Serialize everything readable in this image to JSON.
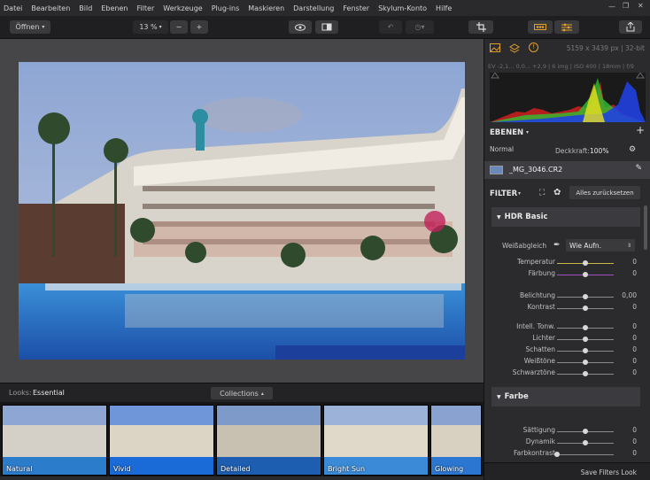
{
  "menu": [
    "Datei",
    "Bearbeiten",
    "Bild",
    "Ebenen",
    "Filter",
    "Werkzeuge",
    "Plug-ins",
    "Maskieren",
    "Darstellung",
    "Fenster",
    "Skylum-Konto",
    "Hilfe"
  ],
  "toolbar": {
    "open_label": "Öffnen",
    "zoom_value": "13 %"
  },
  "panel": {
    "image_info": "5159 x 3439 px  |  32-bit",
    "exif": "EV -2,1... 0,0... +2,9  |  6 img  |  ISO 400  |  18mm  |  f/9",
    "layers_title": "EBENEN",
    "blend_mode": "Normal",
    "opacity_label": "Deckkraft:",
    "opacity_value": "100%",
    "layer_name": "_MG_3046.CR2",
    "filter_title": "FILTER",
    "reset_label": "Alles zurücksetzen",
    "hdr_section": "HDR Basic",
    "wb_label": "Weißabgleich",
    "wb_value": "Wie Aufn.",
    "color_section": "Farbe",
    "save_looks": "Save Filters Look",
    "sliders": [
      {
        "name": "Temperatur",
        "value": "0",
        "level": 0.5,
        "color": "#c8b84a"
      },
      {
        "name": "Färbung",
        "value": "0",
        "level": 0.5,
        "color": "#a050c0"
      },
      {
        "name": "Belichtung",
        "value": "0,00",
        "level": 0.5,
        "color": "#8a8a8a"
      },
      {
        "name": "Kontrast",
        "value": "0",
        "level": 0.5,
        "color": "#8a8a8a"
      },
      {
        "name": "Intell. Tonw.",
        "value": "0",
        "level": 0.5,
        "color": "#8a8a8a"
      },
      {
        "name": "Lichter",
        "value": "0",
        "level": 0.5,
        "color": "#8a8a8a"
      },
      {
        "name": "Schatten",
        "value": "0",
        "level": 0.5,
        "color": "#8a8a8a"
      },
      {
        "name": "Weißtöne",
        "value": "0",
        "level": 0.5,
        "color": "#8a8a8a"
      },
      {
        "name": "Schwarztöne",
        "value": "0",
        "level": 0.5,
        "color": "#8a8a8a"
      },
      {
        "name": "Sättigung",
        "value": "0",
        "level": 0.5,
        "color": "#8a8a8a"
      },
      {
        "name": "Dynamik",
        "value": "0",
        "level": 0.5,
        "color": "#8a8a8a"
      },
      {
        "name": "Farbkontrast",
        "value": "0",
        "level": 0.0,
        "color": "#8a8a8a"
      }
    ]
  },
  "looks": {
    "label": "Looks:",
    "category": "Essential",
    "collections": "Collections",
    "items": [
      "Natural",
      "Vivid",
      "Detailed",
      "Bright Sun",
      "Glowing"
    ]
  }
}
